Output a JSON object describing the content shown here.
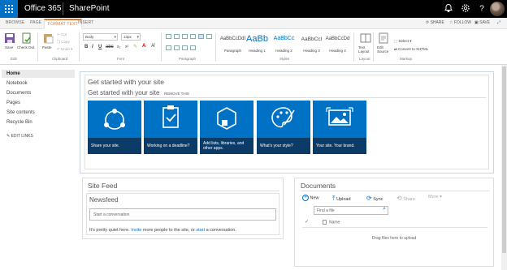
{
  "suite": {
    "product": "Office 365",
    "app": "SharePoint"
  },
  "ribbon_tabs": [
    "BROWSE",
    "PAGE",
    "FORMAT TEXT",
    "INSERT"
  ],
  "ribbon_actions": {
    "share": "SHARE",
    "follow": "FOLLOW",
    "save": "SAVE"
  },
  "ribbon": {
    "edit": {
      "save": "Save",
      "check_out": "Check Out",
      "group": "Edit"
    },
    "clipboard": {
      "paste": "Paste",
      "cut": "Cut",
      "copy": "Copy",
      "undo": "Undo",
      "group": "Clipboard"
    },
    "font": {
      "family": "Body",
      "size": "13px",
      "group": "Font"
    },
    "paragraph": {
      "group": "Paragraph"
    },
    "styles": {
      "group": "Styles",
      "items": [
        {
          "sample": "AaBbCcDdI",
          "label": "Paragraph"
        },
        {
          "sample": "AaBb",
          "label": "Heading 1"
        },
        {
          "sample": "AaBbCc",
          "label": "Heading 2"
        },
        {
          "sample": "AaBbCcI",
          "label": "Heading 3"
        },
        {
          "sample": "AaBbCcDd",
          "label": "Heading 4"
        }
      ]
    },
    "layout": {
      "text_layout": "Text Layout",
      "group": "Layout"
    },
    "markup": {
      "edit_source": "Edit Source",
      "select": "Select",
      "convert": "Convert to XHTML",
      "group": "Markup"
    }
  },
  "leftnav": {
    "items": [
      "Home",
      "Notebook",
      "Documents",
      "Pages",
      "Site contents",
      "Recycle Bin"
    ],
    "edit_links": "EDIT LINKS"
  },
  "get_started": {
    "title": "Get started with your site",
    "subtitle": "Get started with your site",
    "remove": "REMOVE THIS",
    "tiles": [
      {
        "caption": "Share your site.",
        "icon": "share-icon"
      },
      {
        "caption": "Working on a deadline?",
        "icon": "clipboard-check-icon"
      },
      {
        "caption": "Add lists, libraries, and other apps.",
        "icon": "add-apps-icon"
      },
      {
        "caption": "What's your style?",
        "icon": "palette-icon"
      },
      {
        "caption": "Your site. Your brand.",
        "icon": "image-icon"
      }
    ]
  },
  "site_feed": {
    "title": "Site Feed",
    "newsfeed": "Newsfeed",
    "placeholder": "Start a conversation",
    "quiet_prefix": "It's pretty quiet here.",
    "invite": "Invite",
    "quiet_middle": "more people to the site, or",
    "start": "start",
    "quiet_suffix": "a conversation."
  },
  "documents": {
    "title": "Documents",
    "actions": {
      "new": "New",
      "upload": "Upload",
      "sync": "Sync",
      "share": "Share",
      "more": "More"
    },
    "find_placeholder": "Find a file",
    "column_name": "Name",
    "drag_hint": "Drag files here to upload"
  },
  "colors": {
    "accent": "#0072c6",
    "tab_active": "#e1782f",
    "tile_caption": "#0b3b66"
  }
}
